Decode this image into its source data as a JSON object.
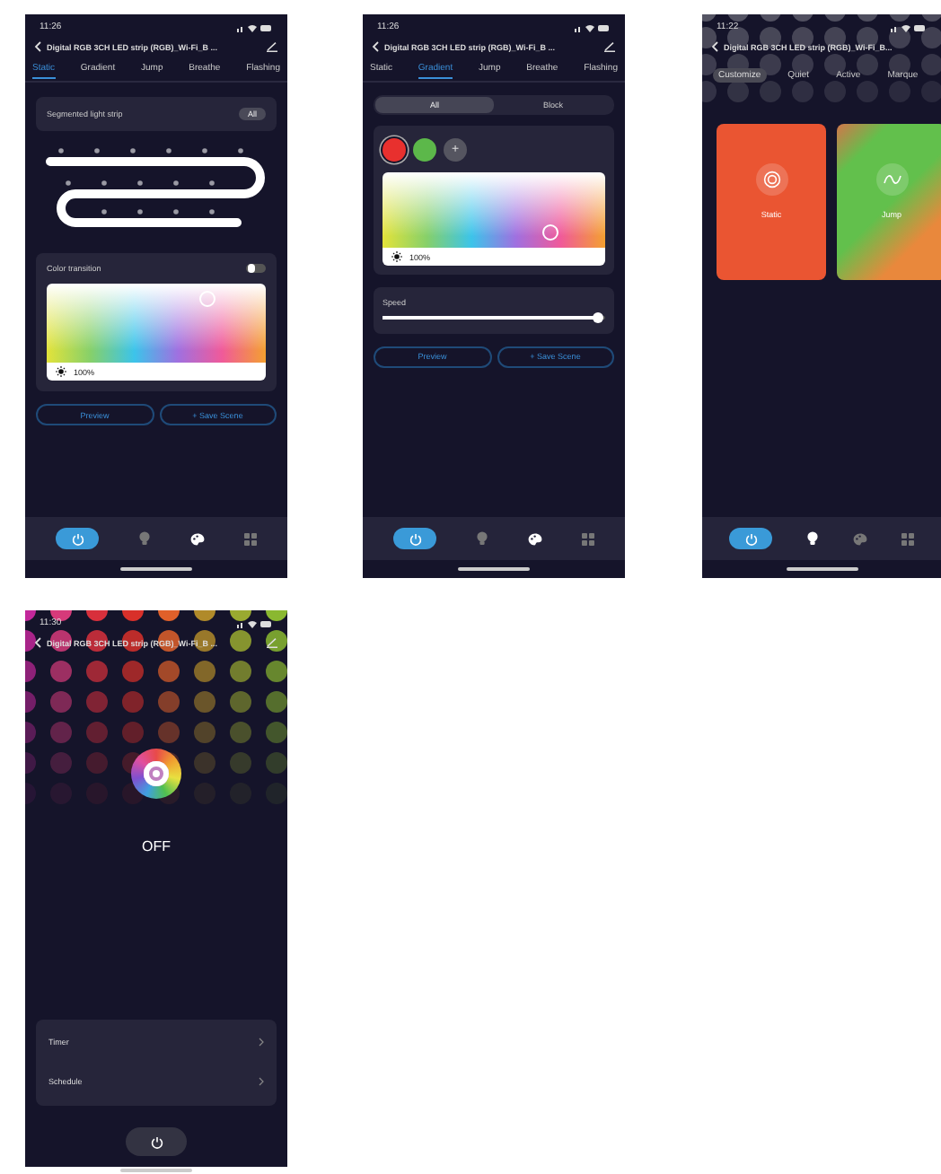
{
  "screens": [
    {
      "kind": "static",
      "time": "11:26",
      "title": "Digital RGB 3CH LED strip (RGB)_Wi-Fi_B ...",
      "tabs": [
        {
          "label": "Static",
          "selected": true
        },
        {
          "label": "Gradient",
          "selected": false
        },
        {
          "label": "Jump",
          "selected": false
        },
        {
          "label": "Breathe",
          "selected": false
        },
        {
          "label": "Flashing",
          "selected": false
        }
      ],
      "segment_card": {
        "label": "Segmented light strip",
        "button": "All"
      },
      "color_card": {
        "label": "Color transition",
        "on": false,
        "brightness": "100%"
      },
      "buttons": [
        "Preview",
        "+ Save Scene"
      ],
      "nav": [
        {
          "selected": false
        },
        {
          "selected": true
        },
        {
          "selected": false
        }
      ]
    },
    {
      "kind": "gradient",
      "time": "11:26",
      "title": "Digital RGB 3CH LED strip (RGB)_Wi-Fi_B ...",
      "tabs": [
        {
          "label": "Static",
          "selected": false
        },
        {
          "label": "Gradient",
          "selected": true
        },
        {
          "label": "Jump",
          "selected": false
        },
        {
          "label": "Breathe",
          "selected": false
        },
        {
          "label": "Flashing",
          "selected": false
        }
      ],
      "segments": [
        {
          "label": "All",
          "selected": true
        },
        {
          "label": "Block",
          "selected": false
        }
      ],
      "swatches": [
        {
          "color": "#e8302e",
          "selected": true
        },
        {
          "color": "#5cb84a",
          "selected": false
        }
      ],
      "add": "+",
      "brightness": "100%",
      "speed": {
        "label": "Speed",
        "level": 0.97
      },
      "buttons": [
        "Preview",
        "+ Save Scene"
      ],
      "nav": [
        {
          "selected": false
        },
        {
          "selected": true
        },
        {
          "selected": false
        }
      ]
    },
    {
      "kind": "scenes",
      "time": "11:22",
      "title": "Digital RGB 3CH LED strip (RGB)_Wi-Fi_B...",
      "tabs": [
        {
          "label": "Customize",
          "selected": true
        },
        {
          "label": "Quiet",
          "selected": false
        },
        {
          "label": "Active",
          "selected": false
        },
        {
          "label": "Marque",
          "selected": false
        }
      ],
      "cards": [
        {
          "kind": "static",
          "label": "Static"
        },
        {
          "kind": "jump",
          "label": "Jump"
        }
      ],
      "nav": [
        {
          "selected": true
        },
        {
          "selected": false
        },
        {
          "selected": false
        }
      ]
    },
    {
      "kind": "power",
      "time": "11:30",
      "title": "Digital RGB 3CH LED strip (RGB)_Wi-Fi_B ...",
      "status": "OFF",
      "items": [
        "Timer",
        "Schedule"
      ]
    }
  ]
}
